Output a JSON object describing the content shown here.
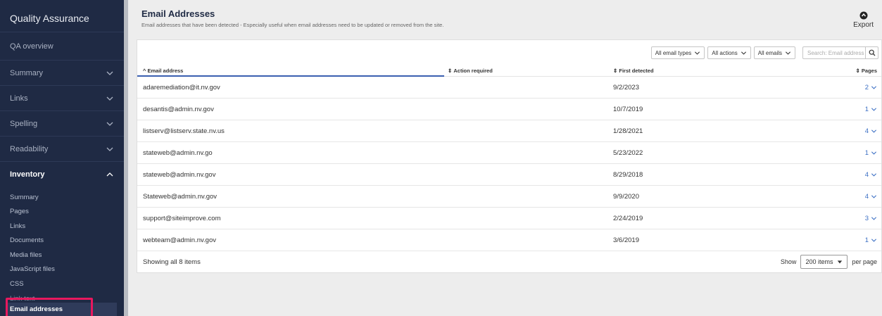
{
  "sidebar": {
    "title": "Quality Assurance",
    "items": [
      {
        "label": "QA overview",
        "chevron": false
      },
      {
        "label": "Summary",
        "chevron": true
      },
      {
        "label": "Links",
        "chevron": true
      },
      {
        "label": "Spelling",
        "chevron": true
      },
      {
        "label": "Readability",
        "chevron": true
      }
    ],
    "open_section": "Inventory",
    "sub_items": [
      "Summary",
      "Pages",
      "Links",
      "Documents",
      "Media files",
      "JavaScript files",
      "CSS"
    ],
    "partial_item": "Link text",
    "active_item": "Email addresses"
  },
  "header": {
    "title": "Email Addresses",
    "description": "Email addresses that have been detected - Especially useful when email addresses need to be updated or removed from the site.",
    "export_label": "Export"
  },
  "filters": {
    "email_types": "All email types",
    "actions": "All actions",
    "emails": "All emails",
    "search_placeholder": "Search: Email address"
  },
  "table": {
    "columns": {
      "email": "Email address",
      "action": "Action required",
      "first": "First detected",
      "pages": "Pages"
    },
    "rows": [
      {
        "email": "adaremediation@it.nv.gov",
        "first": "9/2/2023",
        "pages": "2"
      },
      {
        "email": "desantis@admin.nv.gov",
        "first": "10/7/2019",
        "pages": "1"
      },
      {
        "email": "listserv@listserv.state.nv.us",
        "first": "1/28/2021",
        "pages": "4"
      },
      {
        "email": "stateweb@admin.nv.go",
        "first": "5/23/2022",
        "pages": "1"
      },
      {
        "email": "stateweb@admin.nv.gov",
        "first": "8/29/2018",
        "pages": "4"
      },
      {
        "email": "Stateweb@admin.nv.gov",
        "first": "9/9/2020",
        "pages": "4"
      },
      {
        "email": "support@siteimprove.com",
        "first": "2/24/2019",
        "pages": "3"
      },
      {
        "email": "webteam@admin.nv.gov",
        "first": "3/6/2019",
        "pages": "1"
      }
    ]
  },
  "footer": {
    "showing": "Showing all 8 items",
    "show_label": "Show",
    "per_page_value": "200 items",
    "per_page_label": "per page"
  }
}
